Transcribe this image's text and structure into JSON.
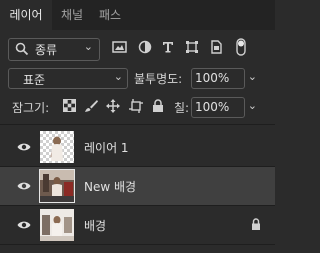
{
  "tabs": [
    {
      "label": "레이어",
      "active": true
    },
    {
      "label": "채널",
      "active": false
    },
    {
      "label": "패스",
      "active": false
    }
  ],
  "filter": {
    "kind_label": "종류",
    "icons": [
      "image-filter-icon",
      "adjustment-filter-icon",
      "type-filter-icon",
      "shape-filter-icon",
      "smart-object-filter-icon",
      "filter-toggle-icon"
    ]
  },
  "blend": {
    "mode": "표준",
    "opacity_label": "불투명도:",
    "opacity_value": "100%"
  },
  "lock": {
    "label": "잠그기:",
    "icons": [
      "lock-transparency-icon",
      "lock-image-icon",
      "lock-position-icon",
      "lock-artboard-icon",
      "lock-all-icon"
    ],
    "fill_label": "칠:",
    "fill_value": "100%"
  },
  "layers": [
    {
      "name": "레이어 1",
      "visible": true,
      "selected": false,
      "locked": false
    },
    {
      "name": "New 배경",
      "visible": true,
      "selected": true,
      "locked": false
    },
    {
      "name": "배경",
      "visible": true,
      "selected": false,
      "locked": true
    }
  ],
  "colors": {
    "panel_bg": "#2b2b2b",
    "tab_bar_bg": "#232323",
    "selected_layer_bg": "#404040",
    "text": "#d6d6d6"
  }
}
